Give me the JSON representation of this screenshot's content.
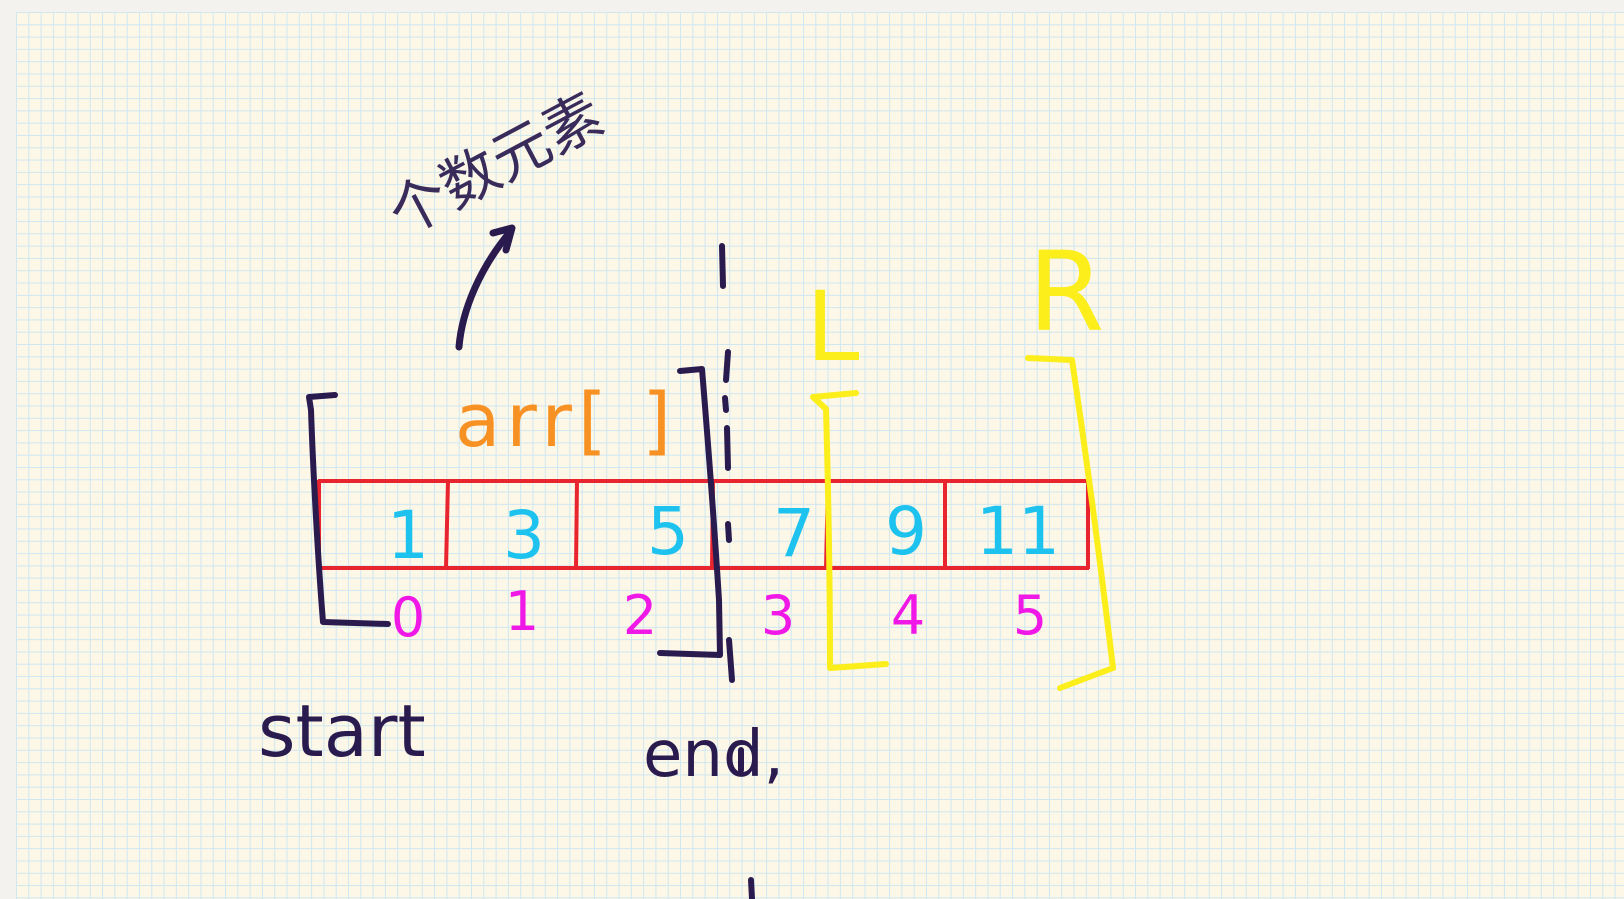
{
  "array_label": "arr[ ]",
  "values": [
    "1",
    "3",
    "5",
    "7",
    "9",
    "11"
  ],
  "indices": [
    "0",
    "1",
    "2",
    "3",
    "4",
    "5"
  ],
  "start_label": "start",
  "end_label": "end,",
  "left_label": "L",
  "right_label": "R",
  "top_note": "个数元素",
  "colors": {
    "ink": "#2a1b4f",
    "orange": "#f79124",
    "cyan": "#1ec2ee",
    "magenta": "#f018e6",
    "red": "#e8242f",
    "yellow": "#fbee1a"
  }
}
